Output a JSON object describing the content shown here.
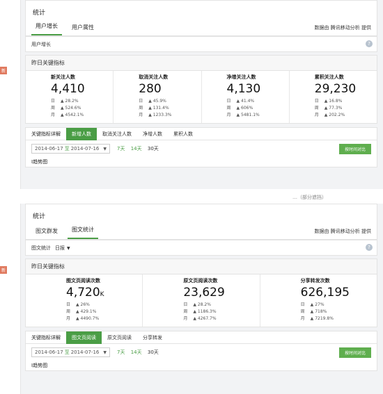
{
  "panel1": {
    "title": "统计",
    "tabs": [
      {
        "label": "用户增长",
        "active": true
      },
      {
        "label": "用户属性",
        "active": false
      }
    ],
    "provider": "数据由 腾讯移动分析 提供",
    "subbar_label": "用户增长",
    "kpi_header": "昨日关键指标",
    "kpis": [
      {
        "label": "新关注人数",
        "value": "4,410",
        "day": "28.2%",
        "week": "524.6%",
        "month": "4542.1%"
      },
      {
        "label": "取消关注人数",
        "value": "280",
        "day": "45.9%",
        "week": "131.4%",
        "month": "1233.3%"
      },
      {
        "label": "净增关注人数",
        "value": "4,130",
        "day": "41.4%",
        "week": "606%",
        "month": "5481.1%"
      },
      {
        "label": "累积关注人数",
        "value": "29,230",
        "day": "16.8%",
        "week": "77.3%",
        "month": "202.2%"
      }
    ],
    "detail_label": "关键指标详解",
    "detail_tabs": [
      {
        "label": "新增人数",
        "active": true
      },
      {
        "label": "取消关注人数",
        "active": false
      },
      {
        "label": "净增人数",
        "active": false
      },
      {
        "label": "累积人数",
        "active": false
      }
    ],
    "range_start": "2014-06-17",
    "range_to": "至",
    "range_end": "2014-07-16",
    "quick_7": "7天",
    "quick_14": "14天",
    "quick_30": "30天",
    "download": "按时间对比",
    "trend_stub": "Ⅰ趋势图"
  },
  "gap_partial": "…（部分遮挡）",
  "panel2": {
    "title": "统计",
    "tabs": [
      {
        "label": "图文群发",
        "active": false
      },
      {
        "label": "图文统计",
        "active": true
      }
    ],
    "provider": "数据由 腾讯移动分析 提供",
    "subbar_label": "图文统计",
    "subbar_dropdown": "日报",
    "kpi_header": "昨日关键指标",
    "kpis": [
      {
        "label": "图文页阅读次数",
        "value": "4,720",
        "suffix": "K",
        "day": "26%",
        "week": "429.1%",
        "month": "4490.7%"
      },
      {
        "label": "原文页阅读次数",
        "value": "23,629",
        "suffix": "",
        "day": "28.2%",
        "week": "1186.3%",
        "month": "4267.7%"
      },
      {
        "label": "分享转发次数",
        "value": "626,195",
        "suffix": "",
        "day": "27%",
        "week": "718%",
        "month": "7219.8%"
      }
    ],
    "detail_label": "关键指标详解",
    "detail_tabs": [
      {
        "label": "图文页阅读",
        "active": true
      },
      {
        "label": "原文页阅读",
        "active": false
      },
      {
        "label": "分享转发",
        "active": false
      }
    ],
    "range_start": "2014-06-17",
    "range_to": "至",
    "range_end": "2014-07-16",
    "quick_7": "7天",
    "quick_14": "14天",
    "quick_30": "30天",
    "download": "按时间对比",
    "trend_stub": "Ⅰ趋势图"
  },
  "tag": "新",
  "labels": {
    "day": "日",
    "week": "周",
    "month": "月",
    "arrow": "▲"
  }
}
